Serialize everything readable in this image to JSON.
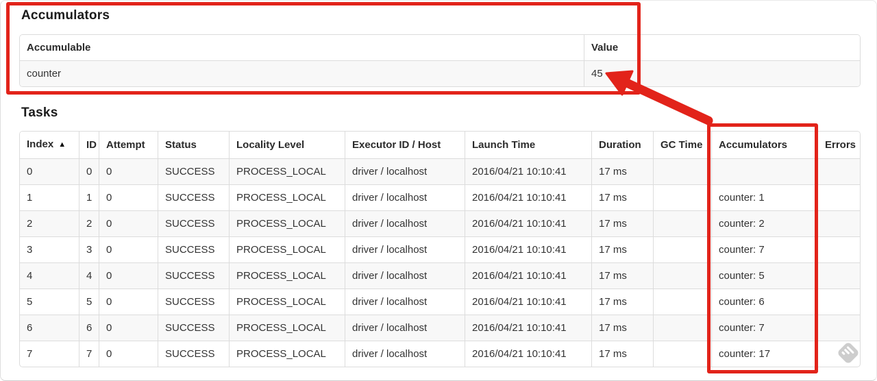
{
  "accumulators_section": {
    "title": "Accumulators",
    "table": {
      "headers": [
        "Accumulable",
        "Value"
      ],
      "rows": [
        [
          "counter",
          "45"
        ]
      ]
    }
  },
  "tasks_section": {
    "title": "Tasks",
    "table": {
      "headers": [
        "Index",
        "ID",
        "Attempt",
        "Status",
        "Locality Level",
        "Executor ID / Host",
        "Launch Time",
        "Duration",
        "GC Time",
        "Accumulators",
        "Errors"
      ],
      "sorted_column_index": 0,
      "sort_ascending_icon": "▲",
      "rows": [
        [
          "0",
          "0",
          "0",
          "SUCCESS",
          "PROCESS_LOCAL",
          "driver / localhost",
          "2016/04/21 10:10:41",
          "17 ms",
          "",
          "",
          ""
        ],
        [
          "1",
          "1",
          "0",
          "SUCCESS",
          "PROCESS_LOCAL",
          "driver / localhost",
          "2016/04/21 10:10:41",
          "17 ms",
          "",
          "counter: 1",
          ""
        ],
        [
          "2",
          "2",
          "0",
          "SUCCESS",
          "PROCESS_LOCAL",
          "driver / localhost",
          "2016/04/21 10:10:41",
          "17 ms",
          "",
          "counter: 2",
          ""
        ],
        [
          "3",
          "3",
          "0",
          "SUCCESS",
          "PROCESS_LOCAL",
          "driver / localhost",
          "2016/04/21 10:10:41",
          "17 ms",
          "",
          "counter: 7",
          ""
        ],
        [
          "4",
          "4",
          "0",
          "SUCCESS",
          "PROCESS_LOCAL",
          "driver / localhost",
          "2016/04/21 10:10:41",
          "17 ms",
          "",
          "counter: 5",
          ""
        ],
        [
          "5",
          "5",
          "0",
          "SUCCESS",
          "PROCESS_LOCAL",
          "driver / localhost",
          "2016/04/21 10:10:41",
          "17 ms",
          "",
          "counter: 6",
          ""
        ],
        [
          "6",
          "6",
          "0",
          "SUCCESS",
          "PROCESS_LOCAL",
          "driver / localhost",
          "2016/04/21 10:10:41",
          "17 ms",
          "",
          "counter: 7",
          ""
        ],
        [
          "7",
          "7",
          "0",
          "SUCCESS",
          "PROCESS_LOCAL",
          "driver / localhost",
          "2016/04/21 10:10:41",
          "17 ms",
          "",
          "counter: 17",
          ""
        ]
      ]
    }
  },
  "annotations": {
    "color": "#e2231a"
  },
  "watermark": {
    "color": "#cdcdcd"
  }
}
